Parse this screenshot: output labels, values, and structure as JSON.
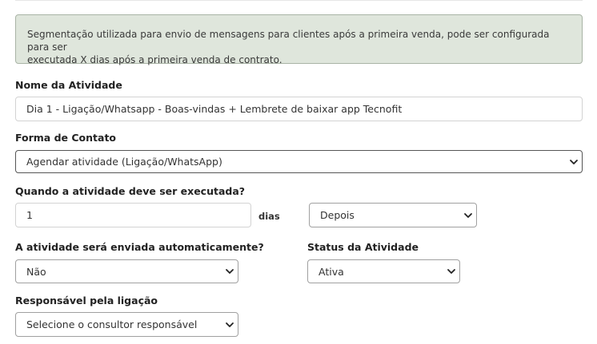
{
  "info": {
    "line1": "Segmentação utilizada para envio de mensagens para clientes após a primeira venda, pode ser configurada para ser",
    "line2": "executada X dias após a primeira venda de contrato."
  },
  "activity_name": {
    "label": "Nome da Atividade",
    "value": "Dia 1 - Ligação/Whatsapp - Boas-vindas + Lembrete de baixar app Tecnofit"
  },
  "contact_form": {
    "label": "Forma de Contato",
    "selected": "Agendar atividade (Ligação/WhatsApp)"
  },
  "schedule": {
    "label": "Quando a atividade deve ser executada?",
    "days_value": "1",
    "days_unit": "dias",
    "relation_selected": "Depois"
  },
  "auto_send": {
    "label": "A atividade será enviada automaticamente?",
    "selected": "Não"
  },
  "status": {
    "label": "Status da Atividade",
    "selected": "Ativa"
  },
  "responsible": {
    "label": "Responsável pela ligação",
    "selected": "Selecione o consultor responsável"
  },
  "icons": {
    "dropdown": "chevron-down-icon"
  }
}
